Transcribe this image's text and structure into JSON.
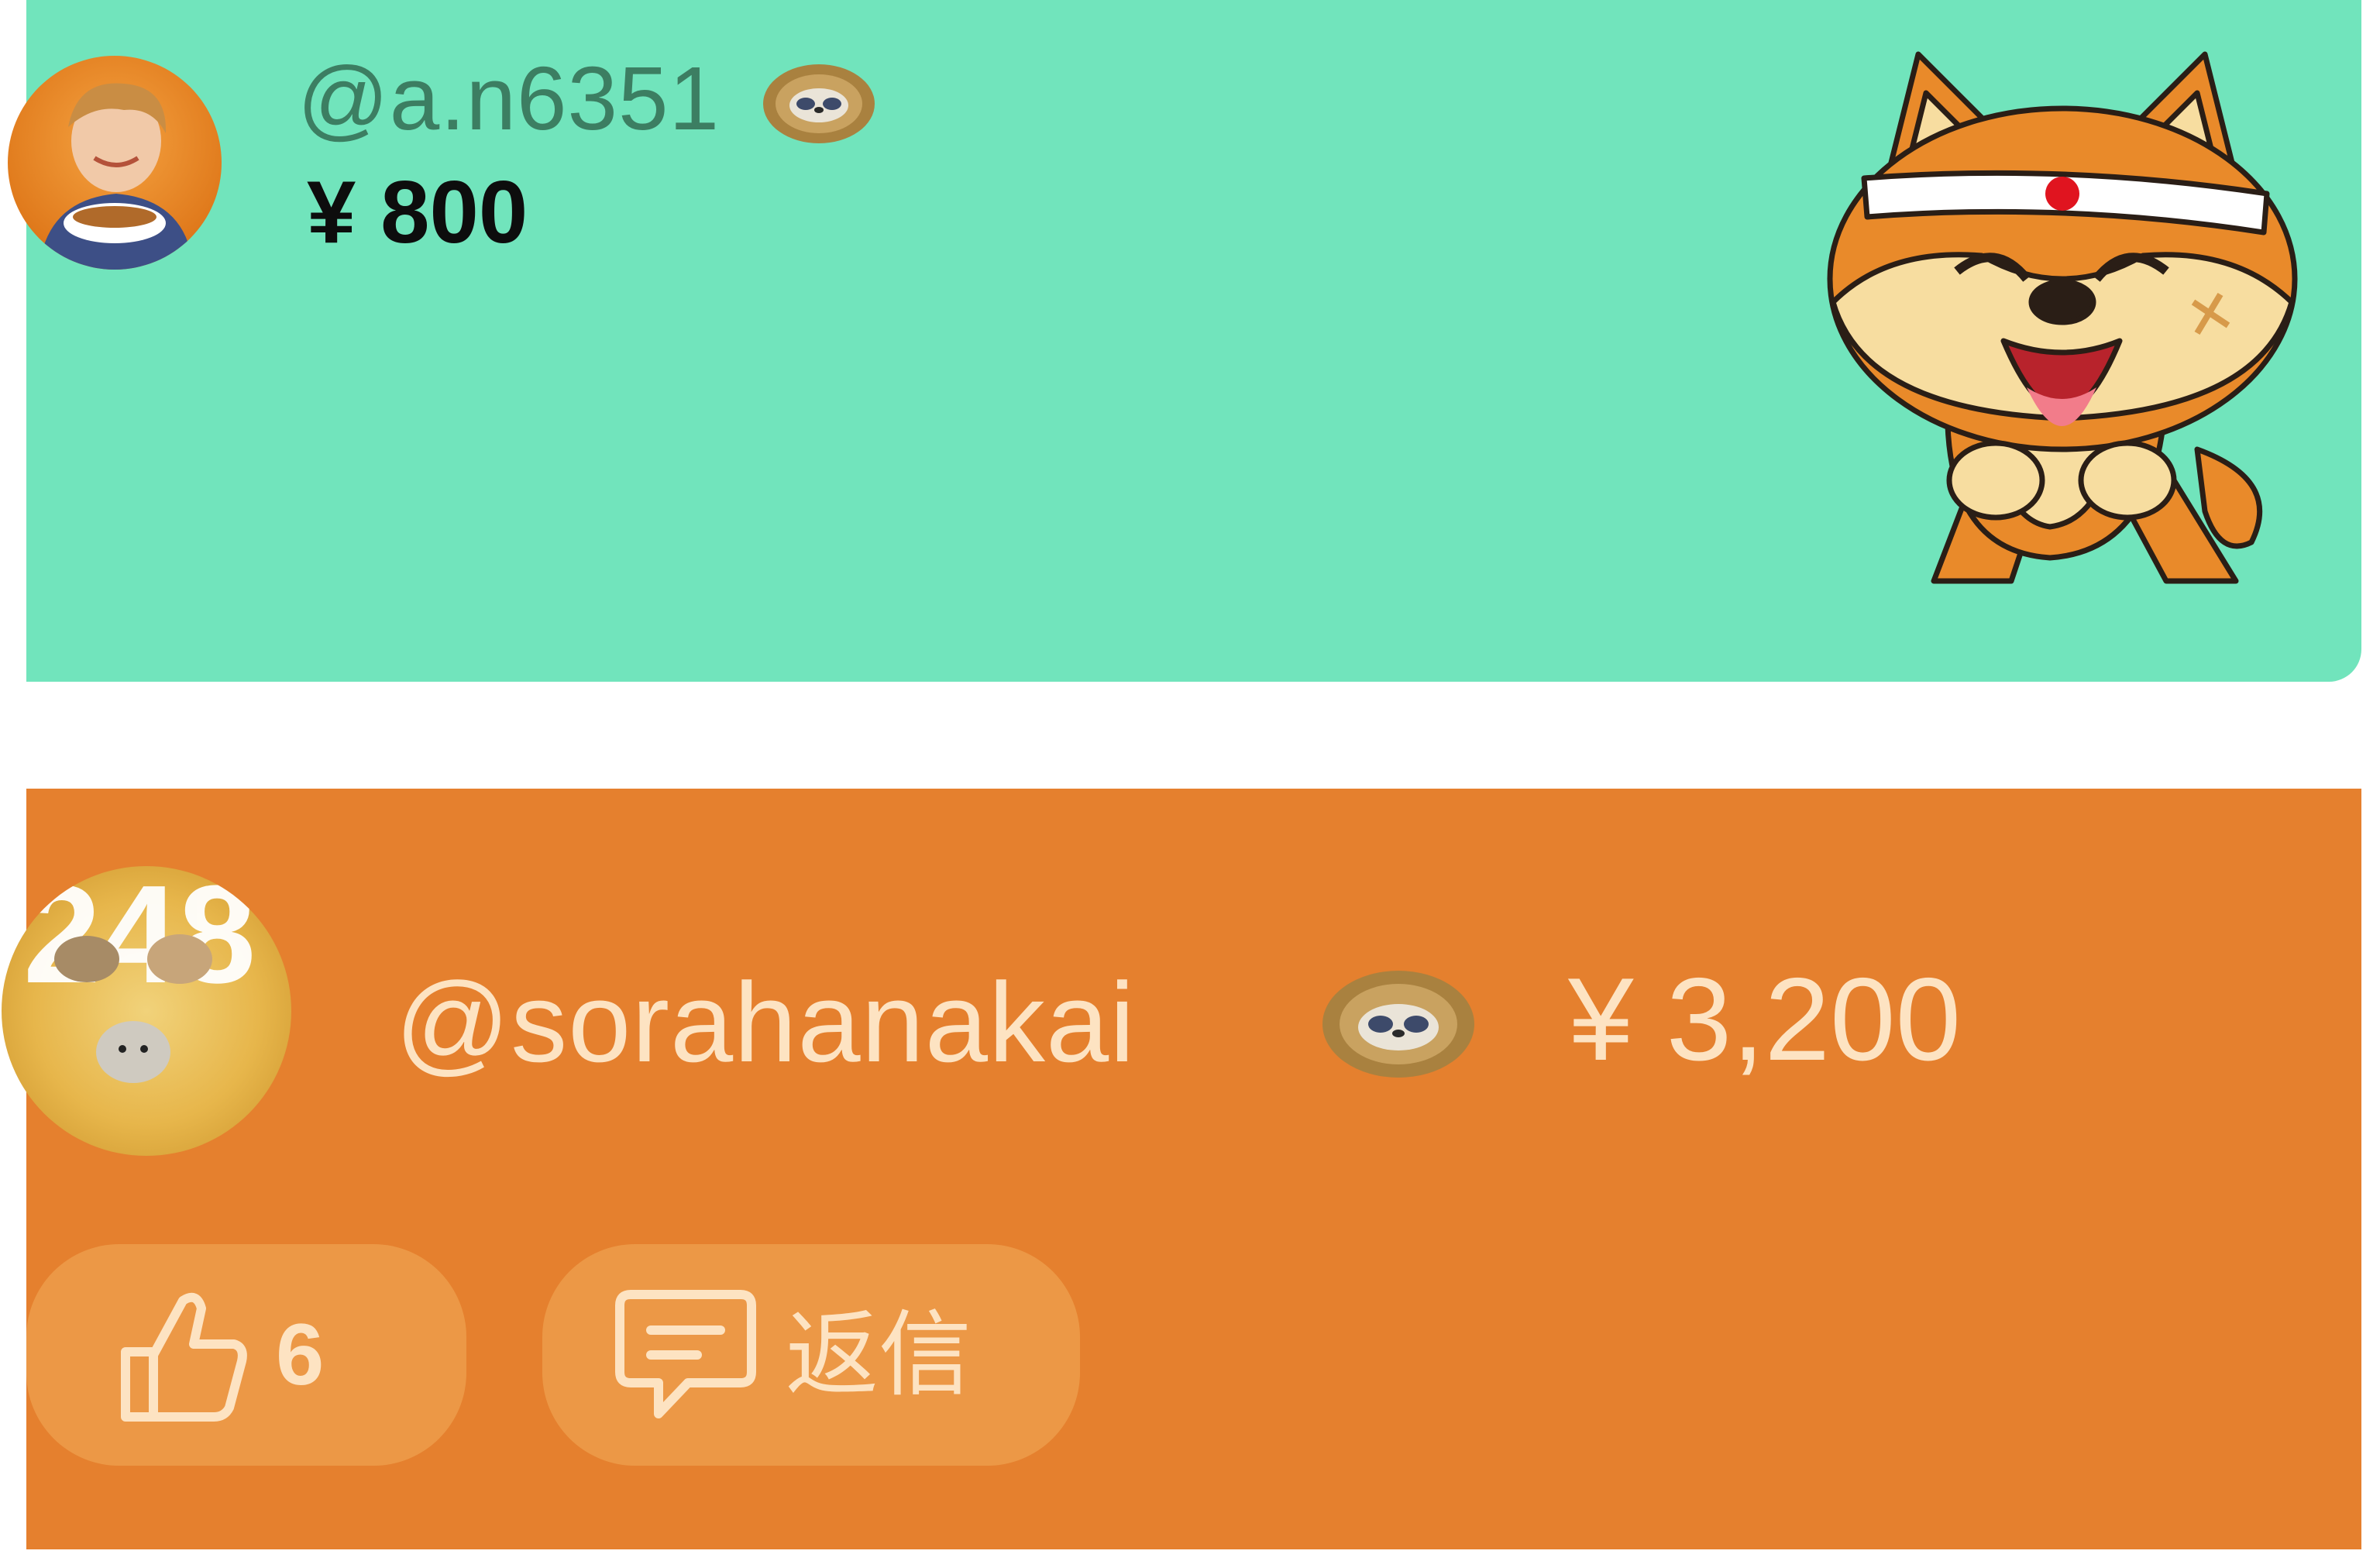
{
  "colors": {
    "card1_bg": "#71e4bc",
    "card2_bg": "#e5802e",
    "handle1_color": "#3c7e62",
    "amount1_color": "#0d0d0d",
    "card2_text": "#fde3c2",
    "pill_bg": "#ec9846"
  },
  "comments": [
    {
      "handle": "@a.n6351",
      "amount": "¥ 800",
      "avatar_icon": "user-avatar-photo",
      "badge_icon": "sloth-badge-icon",
      "sticker_icon": "shiba-dog-sticker"
    },
    {
      "handle": "@sorahanakai",
      "amount": "¥ 3,200",
      "avatar_icon": "user-avatar-248",
      "avatar_text": "248",
      "badge_icon": "sloth-badge-icon",
      "actions": {
        "like_icon": "thumbs-up-icon",
        "like_count": "6",
        "reply_icon": "reply-comment-icon",
        "reply_label": "返信"
      }
    }
  ]
}
